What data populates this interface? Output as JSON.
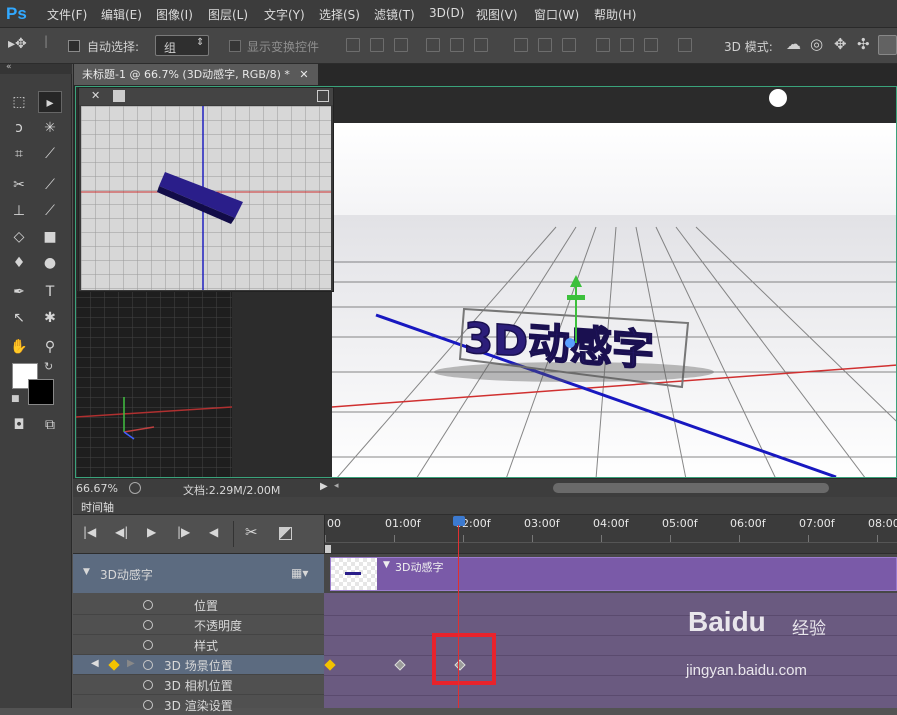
{
  "app": {
    "logo": "Ps"
  },
  "menu": [
    "文件(F)",
    "编辑(E)",
    "图像(I)",
    "图层(L)",
    "文字(Y)",
    "选择(S)",
    "滤镜(T)",
    "3D(D)",
    "视图(V)",
    "窗口(W)",
    "帮助(H)"
  ],
  "options": {
    "auto_select_label": "自动选择:",
    "auto_select_value": "组",
    "show_transform_label": "显示变换控件",
    "mode_label": "3D 模式:"
  },
  "document": {
    "tab_title": "未标题-1 @ 66.7% (3D动感字, RGB/8) *",
    "zoom": "66.67%",
    "doc_info": "文档:2.29M/2.00M",
    "text_3d": "3D动感字"
  },
  "timeline": {
    "panel_title": "时间轴",
    "ruler_labels": [
      "00",
      "01:00f",
      "02:00f",
      "03:00f",
      "04:00f",
      "05:00f",
      "06:00f",
      "07:00f",
      "08:00"
    ],
    "layer_name": "3D动感字",
    "clip_name": "3D动感字",
    "properties": [
      "位置",
      "不透明度",
      "样式",
      "3D 场景位置",
      "3D 相机位置",
      "3D 渲染设置"
    ]
  },
  "watermark": {
    "brand": "Baidu",
    "brand_cn": "经验",
    "url": "jingyan.baidu.com"
  },
  "colors": {
    "accent_purple": "#7a5aa8",
    "playhead": "#e03030",
    "highlight_box": "#e8232b",
    "keyframe_active": "#f2c200"
  }
}
